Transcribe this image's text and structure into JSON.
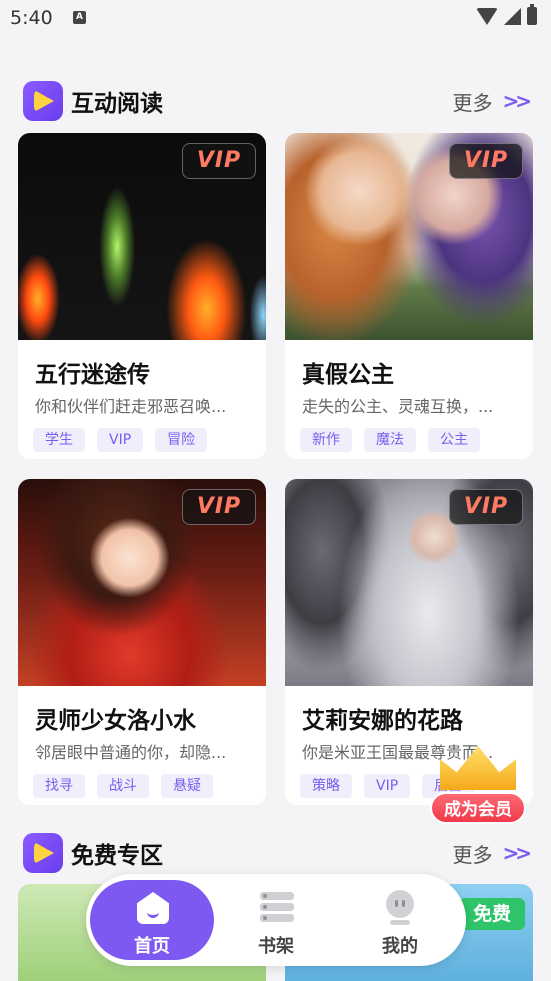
{
  "status_bar": {
    "time": "5:40",
    "notification_icon": "A"
  },
  "sections": {
    "interactive_reading": {
      "title": "互动阅读",
      "more_label": "更多",
      "more_arrow": ">>"
    },
    "free_zone": {
      "title": "免费专区",
      "more_label": "更多",
      "more_arrow": ">>"
    }
  },
  "cards": [
    {
      "title": "五行迷途传",
      "desc": "你和伙伴们赶走邪恶召唤...",
      "badge": "VIP",
      "tags": [
        "学生",
        "VIP",
        "冒险"
      ]
    },
    {
      "title": "真假公主",
      "desc": "走失的公主、灵魂互换，...",
      "badge": "VIP",
      "tags": [
        "新作",
        "魔法",
        "公主"
      ]
    },
    {
      "title": "灵师少女洛小水",
      "desc": "邻居眼中普通的你，却隐...",
      "badge": "VIP",
      "tags": [
        "找寻",
        "战斗",
        "悬疑"
      ]
    },
    {
      "title": "艾莉安娜的花路",
      "desc": "你是米亚王国最最尊贵而...",
      "badge": "VIP",
      "tags": [
        "策略",
        "VIP",
        "后宫"
      ]
    }
  ],
  "member_badge": {
    "label": "成为会员"
  },
  "free_cards": [
    {
      "badge": ""
    },
    {
      "badge": "免费"
    }
  ],
  "bottom_nav": {
    "home": "首页",
    "shelf": "书架",
    "mine": "我的",
    "active": "home"
  },
  "colors": {
    "accent": "#7d59f2",
    "vip_text": "#ff7a63",
    "member": "#ef3a4b",
    "free_badge": "#2fc46a"
  }
}
